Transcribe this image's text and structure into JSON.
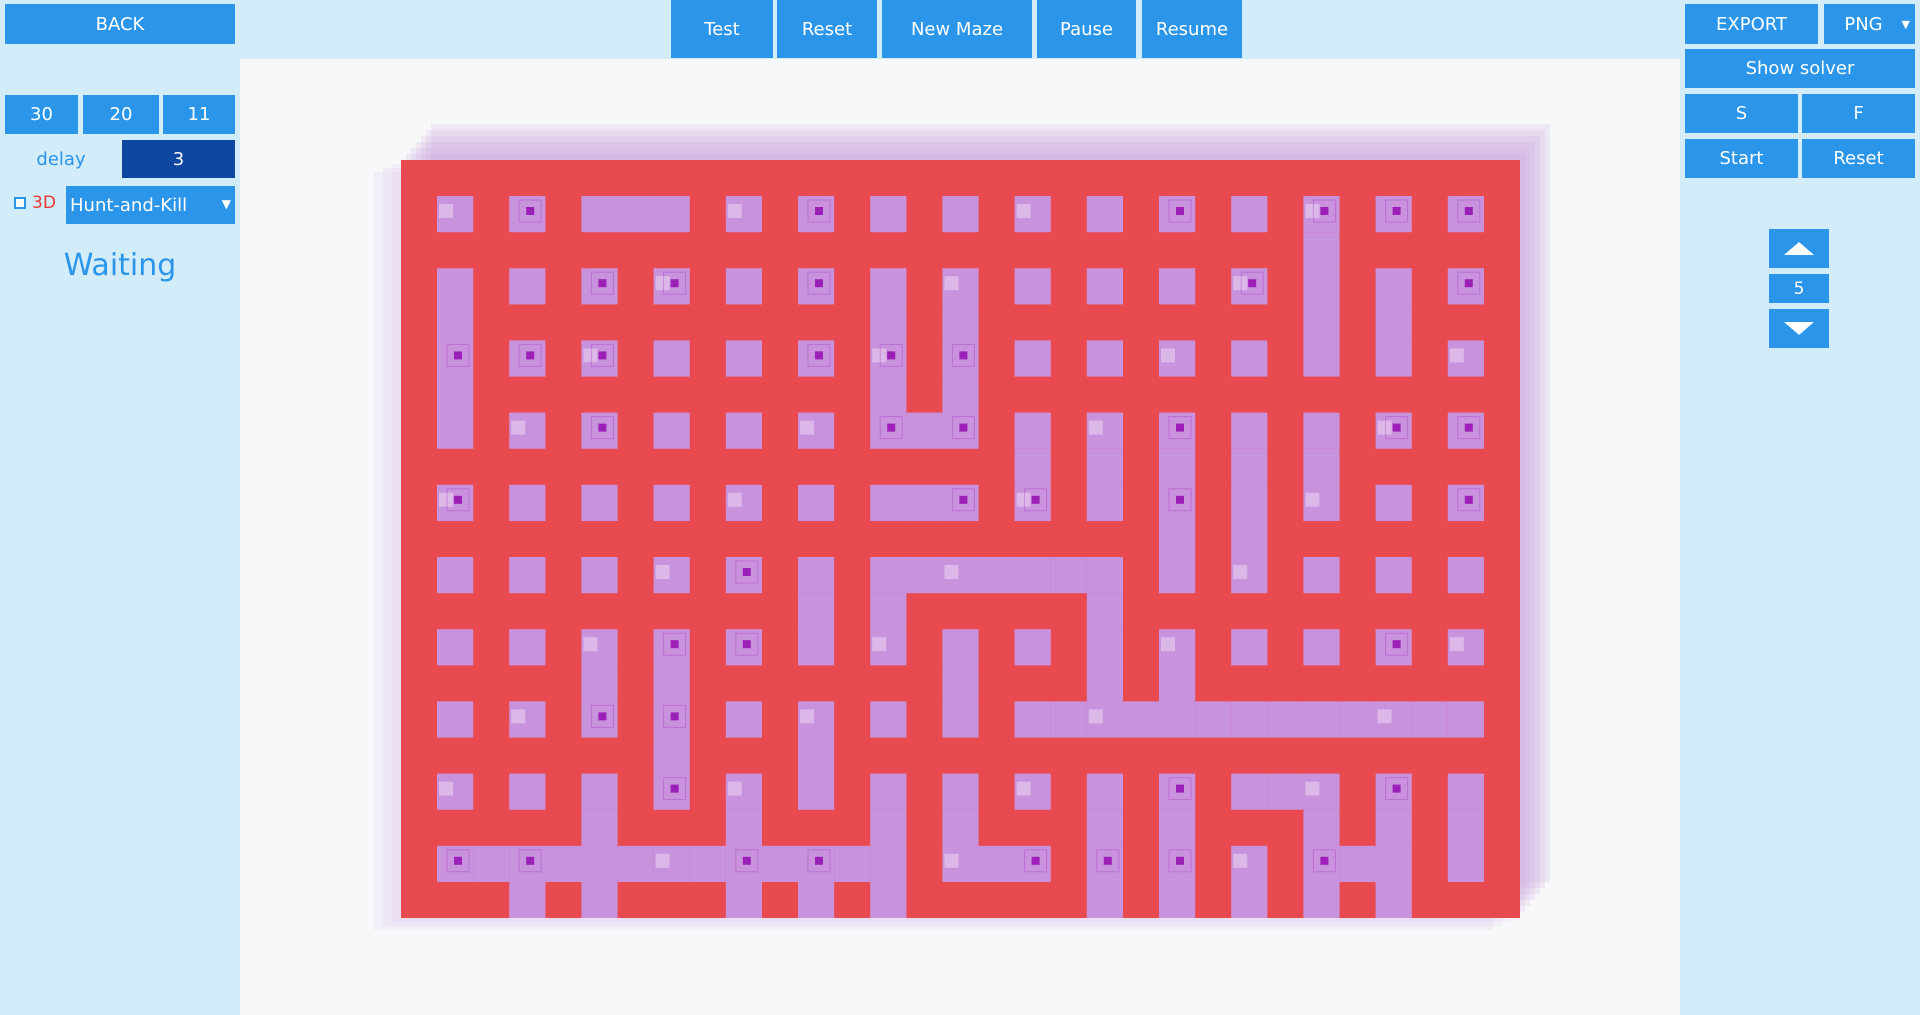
{
  "left_panel": {
    "back_label": "BACK",
    "dim_values": [
      "30",
      "20",
      "11"
    ],
    "delay_label": "delay",
    "delay_value": "3",
    "three_d_label": "3D",
    "algorithm": "Hunt-and-Kill",
    "status": "Waiting"
  },
  "toolbar": {
    "buttons": [
      "Test",
      "Reset",
      "New Maze",
      "Pause",
      "Resume"
    ]
  },
  "right_panel": {
    "export_label": "EXPORT",
    "format_label": "PNG",
    "show_solver_label": "Show solver",
    "s_label": "S",
    "f_label": "F",
    "start_label": "Start",
    "reset_label": "Reset",
    "layer_value": "5"
  },
  "icons": {
    "layer_up": "triangle-up-icon",
    "layer_down": "triangle-down-icon",
    "format_dropdown": "caret-down-icon",
    "algorithm_dropdown": "caret-down-icon",
    "three_d_checkbox": "checkbox-icon"
  },
  "colors": {
    "wall": "#e94a50",
    "path": "#c992dd",
    "marker": "#9c1fb8",
    "button": "#2b95ea",
    "button_dark": "#0d47a1",
    "panel": "#d2ecf9",
    "status_text": "#2b95ea",
    "three_d_label": "#e53935"
  },
  "maze": {
    "cols": 15,
    "rows": 10,
    "open_h": [
      [
        0,
        2
      ],
      [
        3,
        6
      ],
      [
        4,
        6
      ],
      [
        5,
        6
      ],
      [
        5,
        7
      ],
      [
        5,
        8
      ],
      [
        7,
        8
      ],
      [
        7,
        9
      ],
      [
        7,
        10
      ],
      [
        7,
        11
      ],
      [
        7,
        12
      ],
      [
        7,
        13
      ],
      [
        8,
        11
      ],
      [
        9,
        0
      ],
      [
        9,
        1
      ],
      [
        9,
        2
      ],
      [
        9,
        3
      ],
      [
        9,
        4
      ],
      [
        9,
        5
      ],
      [
        9,
        7
      ],
      [
        9,
        12
      ]
    ],
    "open_v": [
      [
        0,
        12
      ],
      [
        1,
        0
      ],
      [
        1,
        6
      ],
      [
        1,
        7
      ],
      [
        1,
        12
      ],
      [
        1,
        13
      ],
      [
        2,
        0
      ],
      [
        2,
        6
      ],
      [
        2,
        7
      ],
      [
        3,
        8
      ],
      [
        3,
        9
      ],
      [
        3,
        10
      ],
      [
        3,
        11
      ],
      [
        3,
        12
      ],
      [
        4,
        10
      ],
      [
        4,
        11
      ],
      [
        5,
        5
      ],
      [
        5,
        6
      ],
      [
        5,
        9
      ],
      [
        6,
        2
      ],
      [
        6,
        3
      ],
      [
        6,
        7
      ],
      [
        6,
        9
      ],
      [
        6,
        10
      ],
      [
        7,
        3
      ],
      [
        7,
        5
      ],
      [
        8,
        2
      ],
      [
        8,
        4
      ],
      [
        8,
        6
      ],
      [
        8,
        7
      ],
      [
        8,
        9
      ],
      [
        8,
        10
      ],
      [
        8,
        12
      ],
      [
        8,
        13
      ],
      [
        8,
        14
      ],
      [
        9,
        1
      ],
      [
        9,
        2
      ],
      [
        9,
        4
      ],
      [
        9,
        5
      ],
      [
        9,
        6
      ],
      [
        9,
        9
      ],
      [
        9,
        10
      ],
      [
        9,
        11
      ],
      [
        9,
        12
      ],
      [
        9,
        13
      ]
    ],
    "markers": [
      [
        0,
        1
      ],
      [
        0,
        5
      ],
      [
        0,
        10
      ],
      [
        0,
        12
      ],
      [
        0,
        13
      ],
      [
        0,
        14
      ],
      [
        1,
        2
      ],
      [
        1,
        3
      ],
      [
        1,
        5
      ],
      [
        1,
        11
      ],
      [
        1,
        14
      ],
      [
        2,
        0
      ],
      [
        2,
        1
      ],
      [
        2,
        2
      ],
      [
        2,
        5
      ],
      [
        2,
        6
      ],
      [
        2,
        7
      ],
      [
        3,
        2
      ],
      [
        3,
        6
      ],
      [
        3,
        7
      ],
      [
        3,
        10
      ],
      [
        3,
        13
      ],
      [
        3,
        14
      ],
      [
        4,
        0
      ],
      [
        4,
        7
      ],
      [
        4,
        8
      ],
      [
        4,
        10
      ],
      [
        4,
        14
      ],
      [
        5,
        4
      ],
      [
        6,
        3
      ],
      [
        6,
        4
      ],
      [
        6,
        13
      ],
      [
        7,
        2
      ],
      [
        7,
        3
      ],
      [
        8,
        3
      ],
      [
        8,
        10
      ],
      [
        8,
        13
      ],
      [
        9,
        0
      ],
      [
        9,
        1
      ],
      [
        9,
        4
      ],
      [
        9,
        5
      ],
      [
        9,
        8
      ],
      [
        9,
        9
      ],
      [
        9,
        10
      ],
      [
        9,
        12
      ]
    ]
  }
}
